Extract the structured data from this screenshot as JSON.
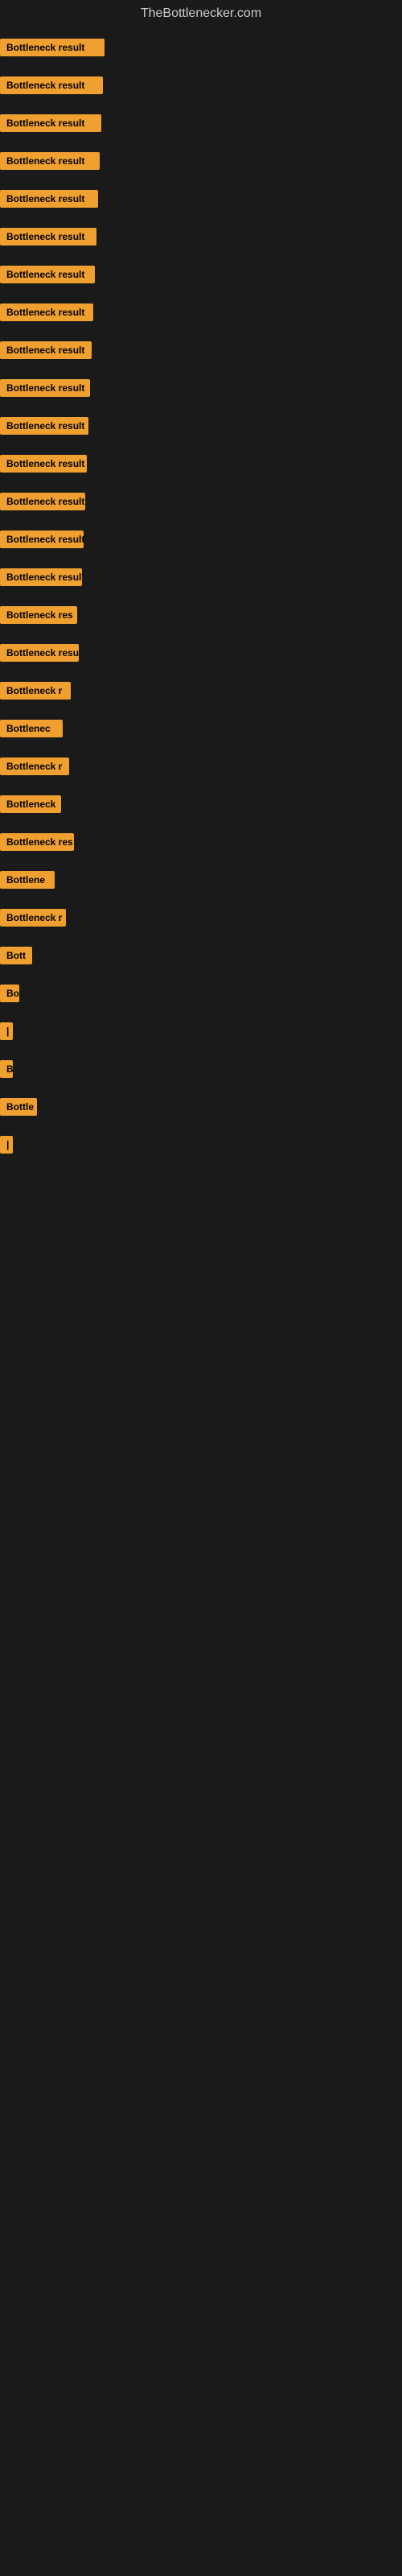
{
  "site": {
    "title": "TheBottlenecker.com"
  },
  "items": [
    {
      "label": "Bottleneck result",
      "width": 130
    },
    {
      "label": "Bottleneck result",
      "width": 128
    },
    {
      "label": "Bottleneck result",
      "width": 126
    },
    {
      "label": "Bottleneck result",
      "width": 124
    },
    {
      "label": "Bottleneck result",
      "width": 122
    },
    {
      "label": "Bottleneck result",
      "width": 120
    },
    {
      "label": "Bottleneck result",
      "width": 118
    },
    {
      "label": "Bottleneck result",
      "width": 116
    },
    {
      "label": "Bottleneck result",
      "width": 114
    },
    {
      "label": "Bottleneck result",
      "width": 112
    },
    {
      "label": "Bottleneck result",
      "width": 110
    },
    {
      "label": "Bottleneck result",
      "width": 108
    },
    {
      "label": "Bottleneck result",
      "width": 106
    },
    {
      "label": "Bottleneck result",
      "width": 104
    },
    {
      "label": "Bottleneck result",
      "width": 102
    },
    {
      "label": "Bottleneck res",
      "width": 96
    },
    {
      "label": "Bottleneck result",
      "width": 98
    },
    {
      "label": "Bottleneck r",
      "width": 88
    },
    {
      "label": "Bottlenec",
      "width": 78
    },
    {
      "label": "Bottleneck r",
      "width": 86
    },
    {
      "label": "Bottleneck",
      "width": 76
    },
    {
      "label": "Bottleneck res",
      "width": 92
    },
    {
      "label": "Bottlene",
      "width": 68
    },
    {
      "label": "Bottleneck r",
      "width": 82
    },
    {
      "label": "Bott",
      "width": 40
    },
    {
      "label": "Bo",
      "width": 24
    },
    {
      "label": "|",
      "width": 8
    },
    {
      "label": "B",
      "width": 16
    },
    {
      "label": "Bottle",
      "width": 46
    },
    {
      "label": "|",
      "width": 6
    }
  ]
}
